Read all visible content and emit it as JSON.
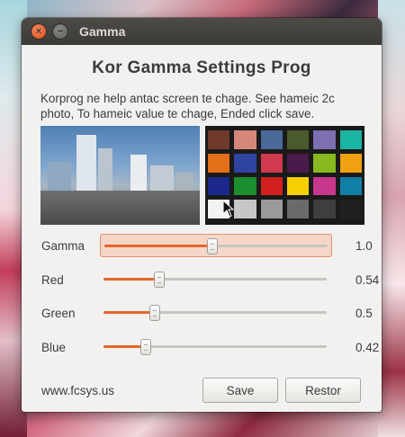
{
  "window": {
    "title": "Gamma",
    "close_glyph": "×",
    "min_glyph": "−"
  },
  "main": {
    "heading": "Kor Gamma Settings Prog",
    "description": "Korprog ne help antac screen te chage. See hameic 2c photo, To hameic value te chage, Ended click save."
  },
  "photos": {
    "city_caption": "photo · city street",
    "checker_caption": "ColorChecker Color Rendition Chart",
    "checker_colors": [
      "#6f3a2c",
      "#d5877a",
      "#4a6a9a",
      "#4b5a2c",
      "#7d6fb0",
      "#1bb3a2",
      "#e36f18",
      "#2f43a0",
      "#cf3a4e",
      "#4a1a4a",
      "#89b820",
      "#f0a010",
      "#1b2a8a",
      "#1c8e30",
      "#d1201e",
      "#f5d000",
      "#c7388d",
      "#0f7fa8",
      "#f2f2f2",
      "#c6c6c6",
      "#9a9a9a",
      "#6a6a6a",
      "#3e3e3e",
      "#1f1f1f"
    ]
  },
  "sliders": [
    {
      "label": "Gamma",
      "value": "1.0",
      "fraction": 0.48,
      "highlight": true
    },
    {
      "label": "Red",
      "value": "0.54",
      "fraction": 0.245,
      "highlight": false
    },
    {
      "label": "Green",
      "value": "0.5",
      "fraction": 0.225,
      "highlight": false
    },
    {
      "label": "Blue",
      "value": "0.42",
      "fraction": 0.185,
      "highlight": false
    }
  ],
  "footer": {
    "link": "www.fcsys.us",
    "save_label": "Save",
    "restor_label": "Restor"
  },
  "colors": {
    "accent": "#e5662a",
    "titlebar": "#3c3b37",
    "window_bg": "#f2f1f0"
  }
}
